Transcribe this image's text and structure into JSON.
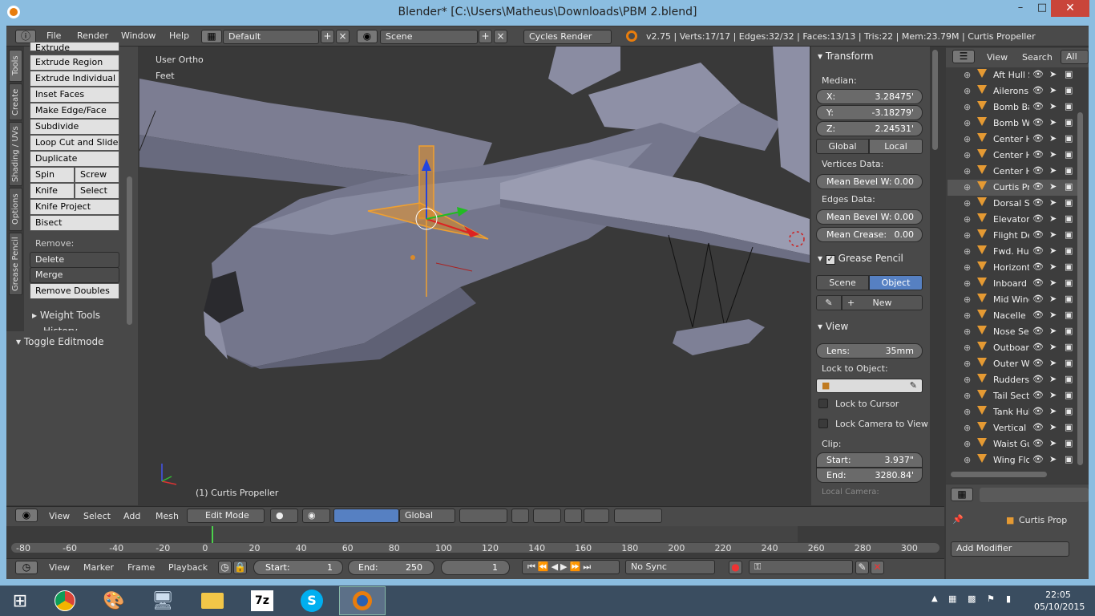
{
  "window": {
    "title": "Blender* [C:\\Users\\Matheus\\Downloads\\PBM 2.blend]"
  },
  "menubar": {
    "file": "File",
    "render": "Render",
    "window": "Window",
    "help": "Help",
    "layout": "Default",
    "scene": "Scene",
    "engine": "Cycles Render",
    "stats": "v2.75 | Verts:17/17 | Edges:32/32 | Faces:13/13 | Tris:22 | Mem:23.79M | Curtis Propeller"
  },
  "toolshelf": {
    "tabs": [
      "Tools",
      "Create",
      "Shading / UVs",
      "Options",
      "Grease Pencil"
    ],
    "buttons": [
      "Extrude",
      "Extrude Region",
      "Extrude Individual",
      "Inset Faces",
      "Make Edge/Face",
      "Subdivide",
      "Loop Cut and Slide",
      "Duplicate"
    ],
    "spin": "Spin",
    "screw": "Screw",
    "knife": "Knife",
    "select": "Select",
    "knife_project": "Knife Project",
    "bisect": "Bisect",
    "remove_label": "Remove:",
    "delete": "Delete",
    "merge": "Merge",
    "remove_doubles": "Remove Doubles",
    "weight_tools": "Weight Tools",
    "history": "History",
    "toggle_editmode": "Toggle Editmode"
  },
  "viewport": {
    "view_name": "User Ortho",
    "units": "Feet",
    "object_label": "(1) Curtis Propeller"
  },
  "npanel": {
    "transform": "Transform",
    "median": "Median:",
    "x_label": "X:",
    "x": "3.28475'",
    "y_label": "Y:",
    "y": "-3.18279'",
    "z_label": "Z:",
    "z": "2.24531'",
    "global": "Global",
    "local": "Local",
    "vertices_data": "Vertices Data:",
    "mean_bevel_w_label": "Mean Bevel W:",
    "mean_bevel_v": "0.00",
    "edges_data": "Edges Data:",
    "mean_bevel_e": "0.00",
    "mean_crease_label": "Mean Crease:",
    "mean_crease": "0.00",
    "grease_pencil": "Grease Pencil",
    "gp_scene": "Scene",
    "gp_object": "Object",
    "gp_new": "New",
    "view": "View",
    "lens_label": "Lens:",
    "lens": "35mm",
    "lock_to_object": "Lock to Object:",
    "lock_to_cursor": "Lock to Cursor",
    "lock_camera": "Lock Camera to View",
    "clip": "Clip:",
    "start_label": "Start:",
    "clip_start": "3.937\"",
    "end_label": "End:",
    "clip_end": "3280.84'",
    "local_camera": "Local Camera:"
  },
  "outliner": {
    "view": "View",
    "search": "Search",
    "all_scenes": "All Sc",
    "items": [
      "Aft Hull S",
      "Ailerons",
      "Bomb Ba",
      "Bomb W",
      "Center H",
      "Center H",
      "Center H",
      "Curtis Pr",
      "Dorsal S",
      "Elevator",
      "Flight De",
      "Fwd. Hu",
      "Horizont",
      "Inboard t",
      "Mid Wing",
      "Nacelle",
      "Nose Sec",
      "Outboar",
      "Outer W",
      "Rudders",
      "Tail Sect",
      "Tank Hul",
      "Vertical",
      "Waist Gu",
      "Wing Flo"
    ]
  },
  "properties": {
    "object": "Curtis Prop",
    "add_modifier": "Add Modifier"
  },
  "viewport_header": {
    "view": "View",
    "select": "Select",
    "add": "Add",
    "mesh": "Mesh",
    "mode": "Edit Mode",
    "orientation": "Global"
  },
  "timeline": {
    "ticks": [
      "-80",
      "-60",
      "-40",
      "-20",
      "0",
      "20",
      "40",
      "60",
      "80",
      "100",
      "120",
      "140",
      "160",
      "180",
      "200",
      "220",
      "240",
      "260",
      "280",
      "300"
    ],
    "view": "View",
    "marker": "Marker",
    "frame": "Frame",
    "playback": "Playback",
    "start_label": "Start:",
    "start": "1",
    "end_label": "End:",
    "end": "250",
    "current": "1",
    "sync": "No Sync"
  },
  "taskbar": {
    "time": "22:05",
    "date": "05/10/2015"
  }
}
